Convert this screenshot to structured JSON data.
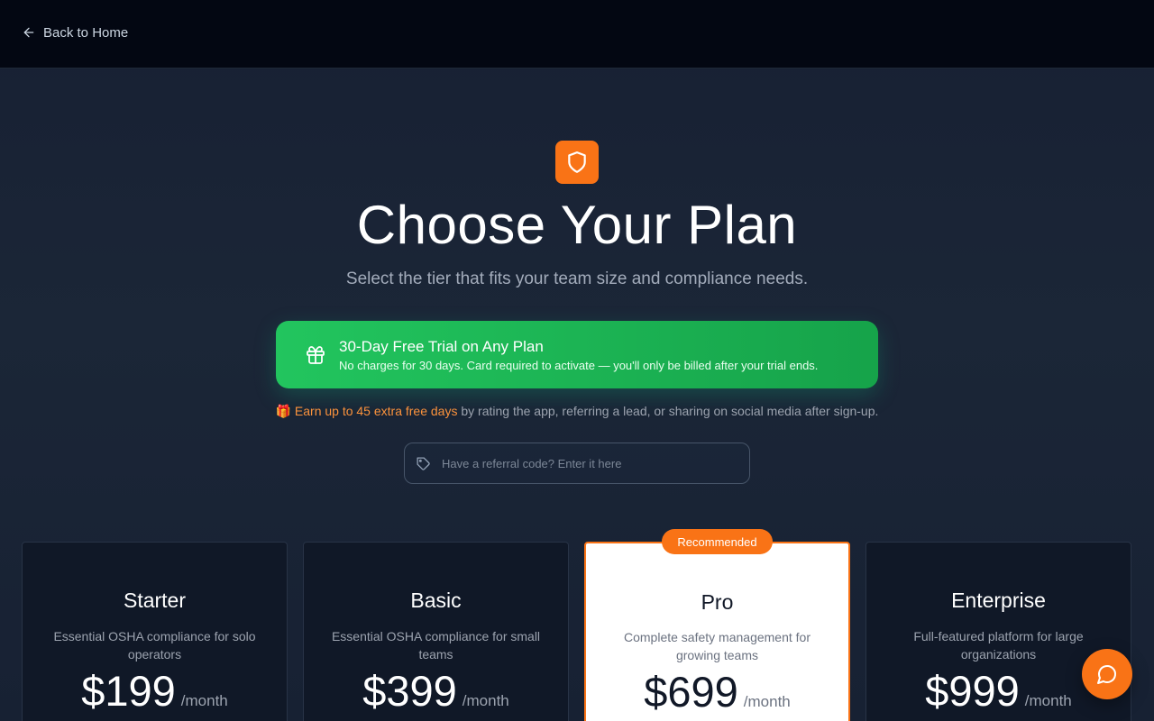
{
  "nav": {
    "back_label": "Back to Home"
  },
  "hero": {
    "icon": "shield-icon",
    "title": "Choose Your Plan",
    "subtitle": "Select the tier that fits your team size and compliance needs."
  },
  "trial": {
    "icon": "gift-icon",
    "title": "30-Day Free Trial on Any Plan",
    "subtitle": "No charges for 30 days. Card required to activate — you'll only be billed after your trial ends."
  },
  "extra_days": {
    "emoji": "🎁",
    "highlight": "Earn up to 45 extra free days",
    "rest": " by rating the app, referring a lead, or sharing on social media after sign-up."
  },
  "referral": {
    "icon": "tag-icon",
    "placeholder": "Have a referral code? Enter it here",
    "value": ""
  },
  "plans": [
    {
      "name": "Starter",
      "description": "Essential OSHA compliance for solo operators",
      "price": "$199",
      "period": "/month"
    },
    {
      "name": "Basic",
      "description": "Essential OSHA compliance for small teams",
      "price": "$399",
      "period": "/month"
    },
    {
      "name": "Pro",
      "description": "Complete safety management for growing teams",
      "price": "$699",
      "period": "/month",
      "badge": "Recommended"
    },
    {
      "name": "Enterprise",
      "description": "Full-featured platform for large organizations",
      "price": "$999",
      "period": "/month"
    }
  ],
  "chat": {
    "icon": "chat-bubble-icon"
  },
  "colors": {
    "accent": "#f97316",
    "trial_green": "#22c55e",
    "background": "#1b2637",
    "topbar": "#030712"
  }
}
